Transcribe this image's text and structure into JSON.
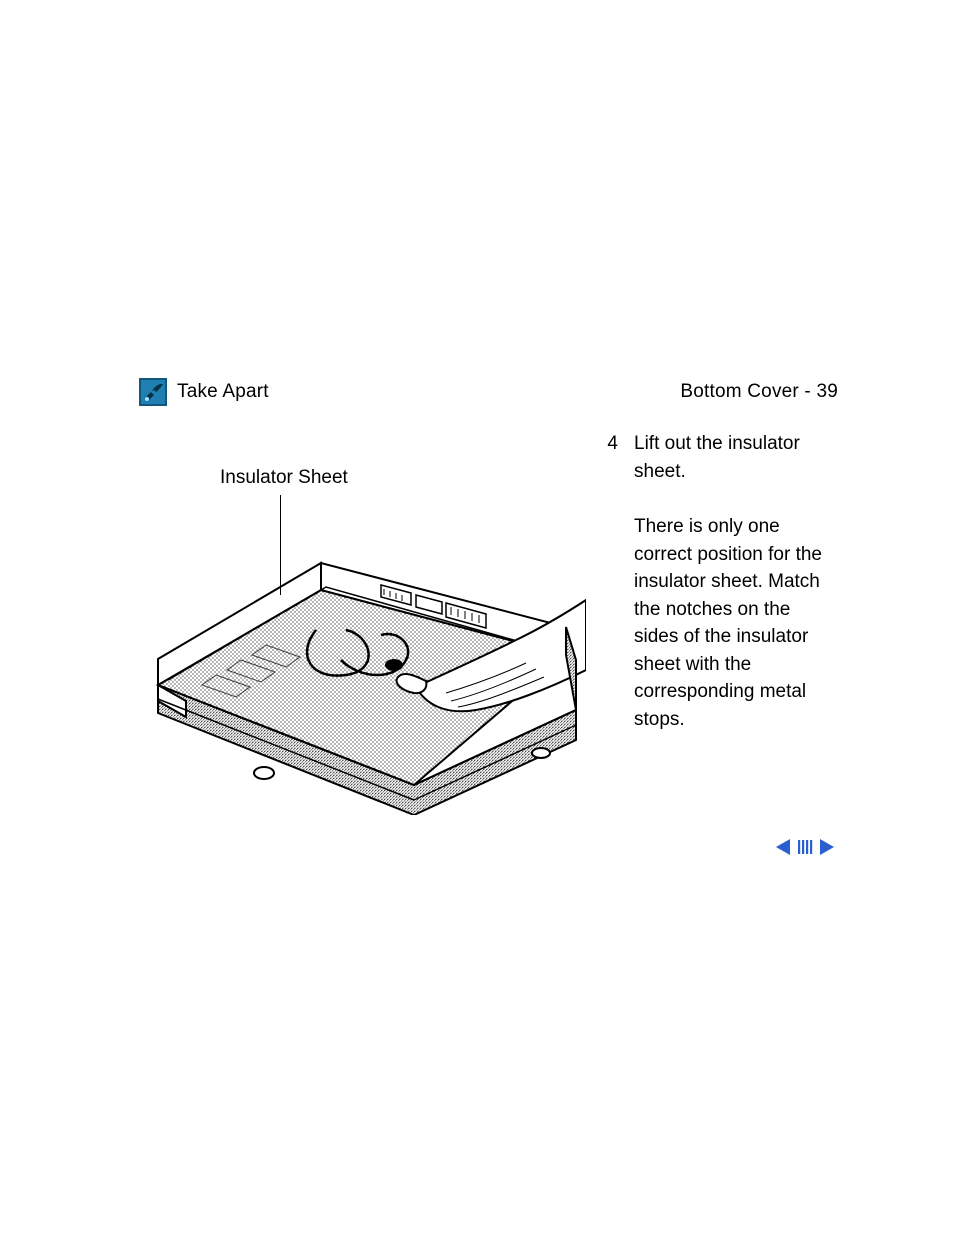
{
  "header": {
    "section": "Take Apart",
    "topic": "Bottom Cover",
    "separator": " - ",
    "page": "39"
  },
  "figure": {
    "label": "Insulator Sheet"
  },
  "step": {
    "number": "4",
    "text": "Lift out the insulator sheet."
  },
  "note": "There is only one correct position for the insulator sheet. Match the notches on the sides of the insulator sheet with the corresponding metal stops.",
  "colors": {
    "nav": "#2a5fd0",
    "icon_bg": "#1f7fb2",
    "icon_fg": "#0a3a5a"
  }
}
